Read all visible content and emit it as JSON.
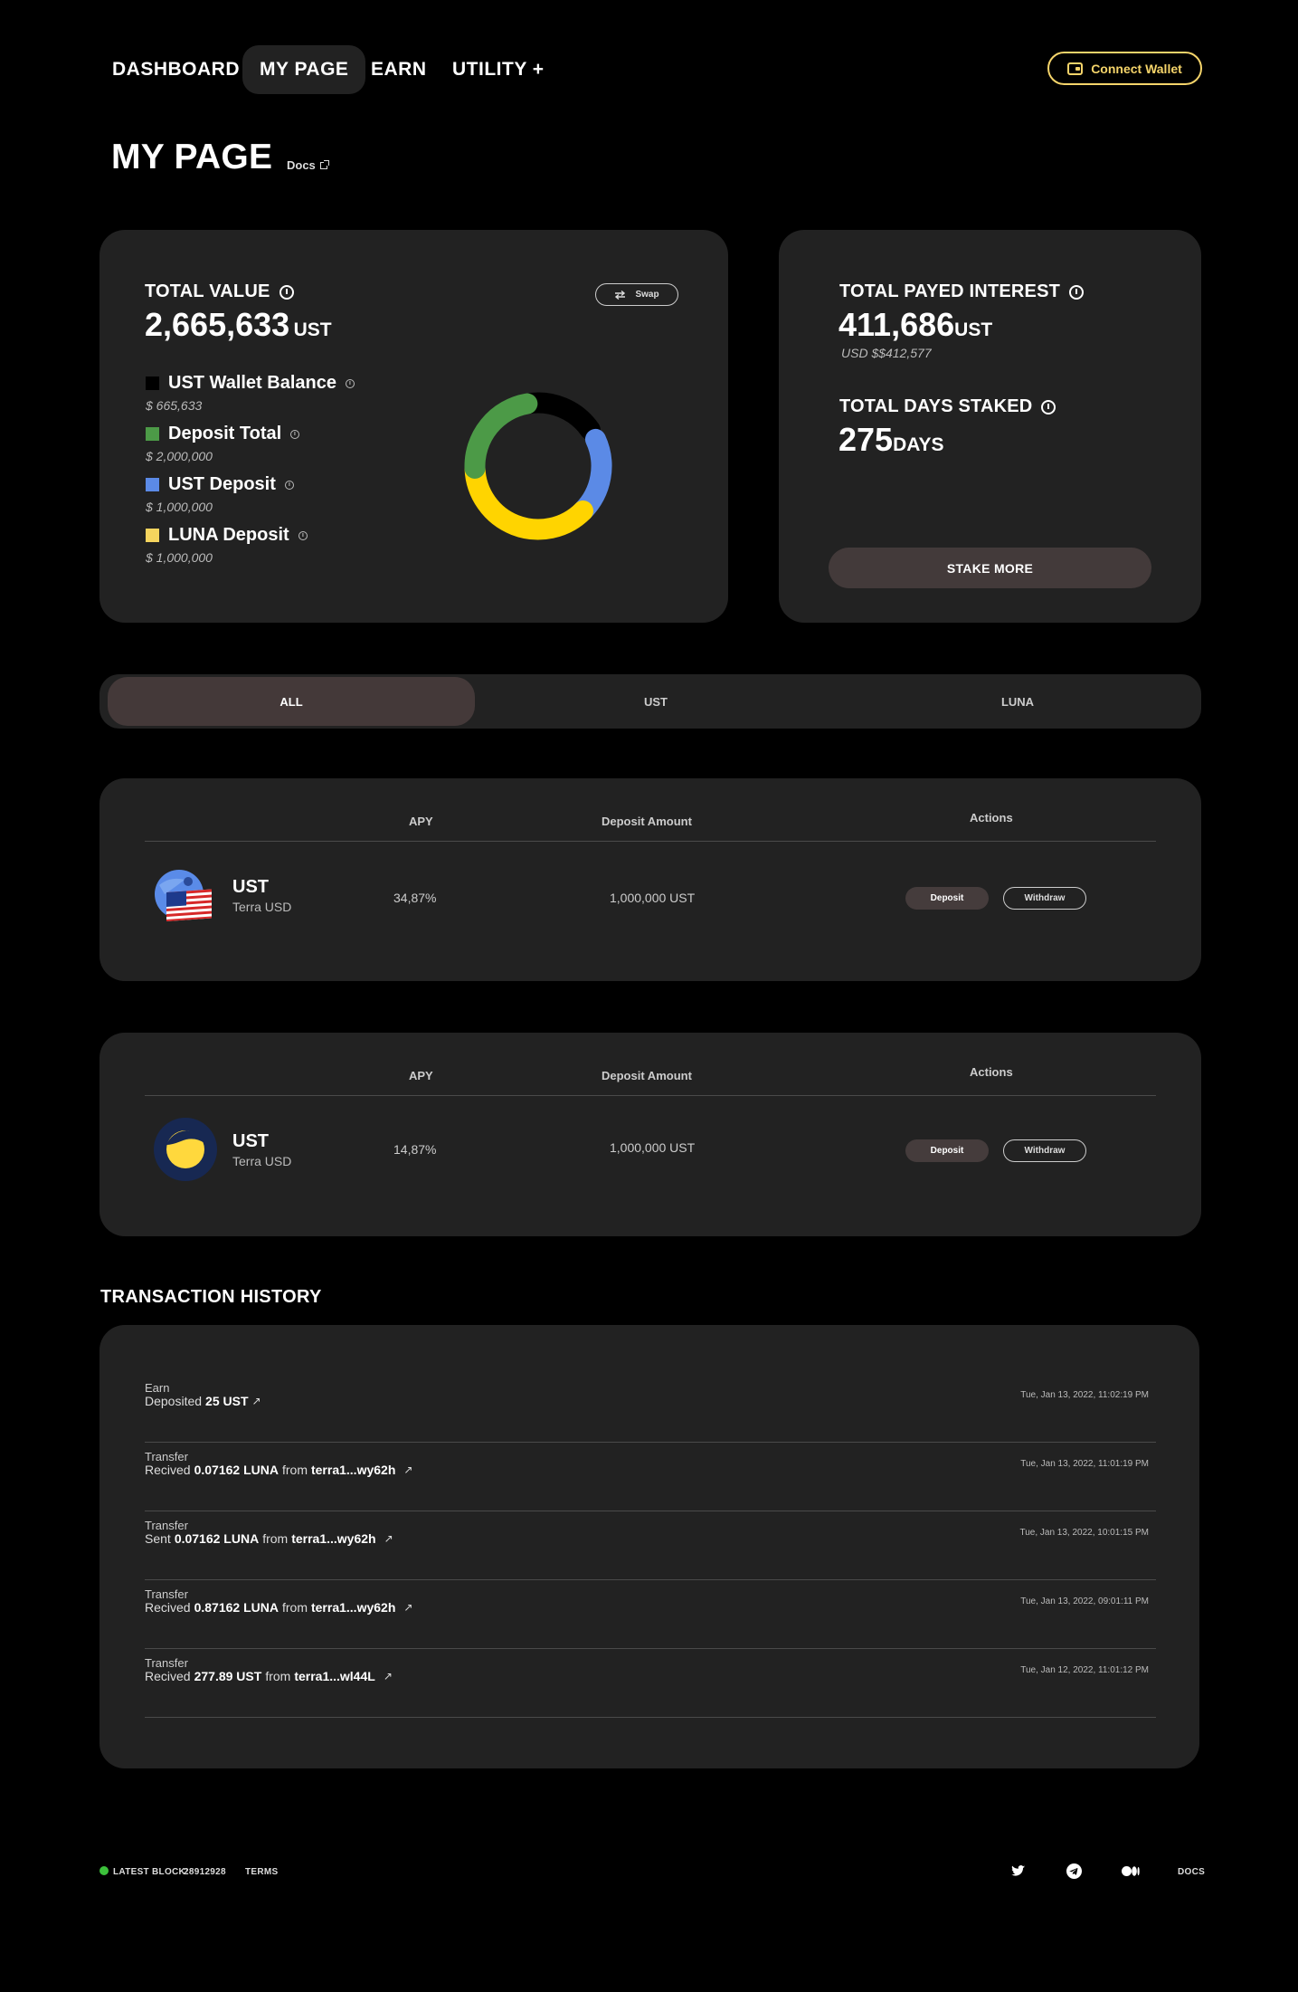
{
  "nav": {
    "items": [
      "DASHBOARD",
      "MY PAGE",
      "EARN",
      "UTILITY +"
    ],
    "active": "MY PAGE",
    "connect_label": "Connect Wallet"
  },
  "page": {
    "title": "MY PAGE",
    "docs_label": "Docs"
  },
  "total_value": {
    "label": "TOTAL VALUE",
    "amount": "2,665,633",
    "unit": "UST",
    "swap_label": "Swap",
    "legend": [
      {
        "label": "UST Wallet Balance",
        "value": "$ 665,633",
        "color": "#000000"
      },
      {
        "label": "Deposit Total",
        "value": "$ 2,000,000",
        "color": "#4c9a47"
      },
      {
        "label": "UST Deposit",
        "value": "$ 1,000,000",
        "color": "#5b8ae6"
      },
      {
        "label": "LUNA Deposit",
        "value": "$ 1,000,000",
        "color": "#f5d45e"
      }
    ]
  },
  "donut": {
    "segments": [
      {
        "name": "ust-wallet",
        "color": "#000000",
        "start": 350,
        "end": 55
      },
      {
        "name": "ust-deposit",
        "color": "#5b8ae6",
        "start": 65,
        "end": 135
      },
      {
        "name": "luna-deposit",
        "color": "#ffd400",
        "start": 135,
        "end": 268
      },
      {
        "name": "deposit-total",
        "color": "#4c9a47",
        "start": 268,
        "end": 350
      }
    ]
  },
  "interest": {
    "label": "TOTAL PAYED INTEREST",
    "amount": "411,686",
    "unit": "UST",
    "usd": "USD $$412,577",
    "days_label": "TOTAL DAYS STAKED",
    "days": "275",
    "days_unit": "DAYS",
    "stake_label": "STAKE MORE"
  },
  "tabs": [
    "ALL",
    "UST",
    "LUNA"
  ],
  "table_headers": {
    "apy": "APY",
    "deposit": "Deposit Amount",
    "actions": "Actions"
  },
  "pools": [
    {
      "name": "UST",
      "sub": "Terra USD",
      "apy": "34,87%",
      "amount": "1,000,000 UST",
      "deposit": "Deposit",
      "withdraw": "Withdraw"
    },
    {
      "name": "UST",
      "sub": "Terra USD",
      "apy": "14,87%",
      "amount": "1,000,000 UST",
      "deposit": "Deposit",
      "withdraw": "Withdraw"
    }
  ],
  "history": {
    "title": "TRANSACTION HISTORY",
    "items": [
      {
        "type": "Earn",
        "verb": "Deposited",
        "amount": "25 UST",
        "from": "",
        "addr": "",
        "time": "Tue, Jan 13, 2022, 11:02:19 PM"
      },
      {
        "type": "Transfer",
        "verb": "Recived",
        "amount": "0.07162 LUNA",
        "from": "from",
        "addr": "terra1...wy62h",
        "time": "Tue, Jan 13, 2022, 11:01:19 PM"
      },
      {
        "type": "Transfer",
        "verb": "Sent",
        "amount": "0.07162 LUNA",
        "from": "from",
        "addr": "terra1...wy62h",
        "time": "Tue, Jan 13, 2022, 10:01:15 PM"
      },
      {
        "type": "Transfer",
        "verb": "Recived",
        "amount": "0.87162 LUNA",
        "from": "from",
        "addr": "terra1...wy62h",
        "time": "Tue, Jan 13, 2022, 09:01:11 PM"
      },
      {
        "type": "Transfer",
        "verb": "Recived",
        "amount": "277.89 UST",
        "from": "from",
        "addr": "terra1...wl44L",
        "time": "Tue, Jan 12, 2022, 11:01:12 PM"
      }
    ]
  },
  "footer": {
    "latest_block_label": "LATEST BLOCK:",
    "latest_block": "28912928",
    "terms": "TERMS",
    "docs": "DOCS",
    "status_color": "#3cc13b",
    "icons": [
      "twitter-icon",
      "telegram-icon",
      "medium-icon"
    ]
  }
}
